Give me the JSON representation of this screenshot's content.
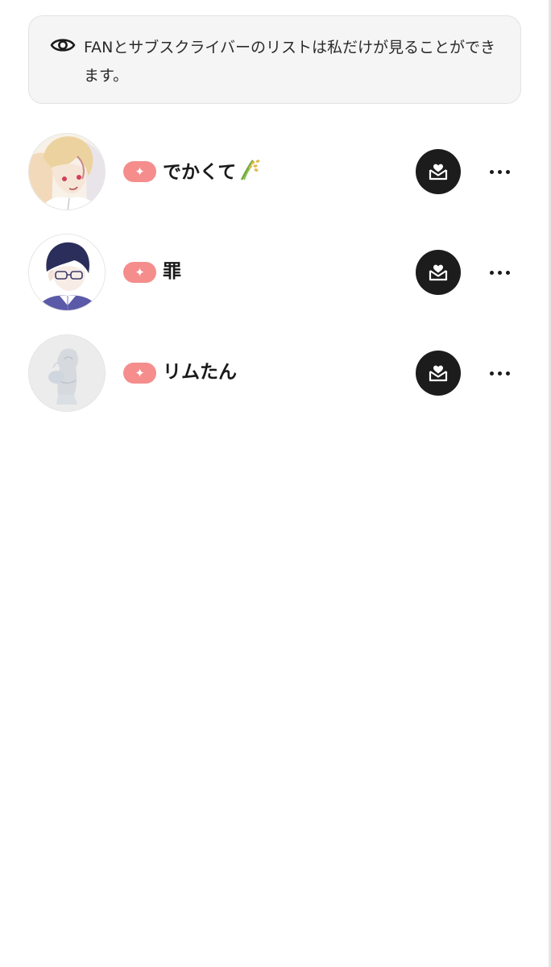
{
  "notice": {
    "icon": "eye-icon",
    "text": "FANとサブスクライバーのリストは私だけが見ることができます。"
  },
  "colors": {
    "badge": "#f58d8d",
    "action_button": "#1c1c1c",
    "notice_background": "#f5f5f5"
  },
  "members": [
    {
      "name": "でかくて",
      "name_emoji": "rice-plant-icon",
      "badge_icon": "sparkle-icon",
      "action_icon": "heart-envelope-icon",
      "more_icon": "more-horizontal-icon"
    },
    {
      "name": "罪",
      "badge_icon": "sparkle-icon",
      "action_icon": "heart-envelope-icon",
      "more_icon": "more-horizontal-icon"
    },
    {
      "name": "リムたん",
      "badge_icon": "sparkle-icon",
      "action_icon": "heart-envelope-icon",
      "more_icon": "more-horizontal-icon"
    }
  ]
}
